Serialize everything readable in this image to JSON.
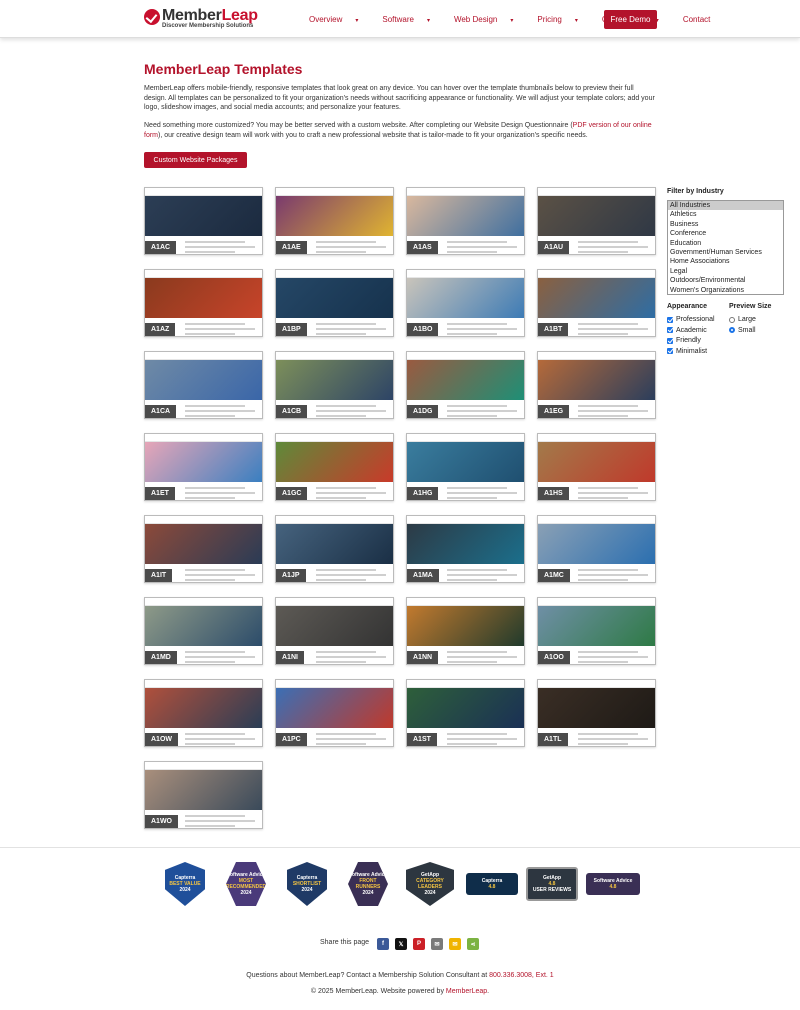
{
  "header": {
    "logo_name_a": "Member",
    "logo_name_b": "Leap",
    "logo_tagline": "Discover Membership Solutions",
    "nav": [
      "Overview",
      "Software",
      "Web Design",
      "Pricing",
      "Get Started",
      "Contact"
    ],
    "nav_has_dropdown": [
      true,
      true,
      true,
      true,
      true,
      false
    ],
    "demo_button": "Free Demo"
  },
  "page": {
    "title": "MemberLeap Templates",
    "intro": "MemberLeap offers mobile-friendly, responsive templates that look great on any device. You can hover over the template thumbnails below to preview their full design. All templates can be personalized to fit your organization's needs without sacrificing appearance or functionality. We will adjust your template colors; add your logo, slideshow images, and social media accounts; and personalize your features.",
    "intro2_a": "Need something more customized? You may be better served with a custom website. After completing our Website Design Questionnaire (",
    "intro2_link": "PDF version of our online form",
    "intro2_b": "), our creative design team will work with you to craft a new professional website that is tailor-made to fit your organization's specific needs.",
    "packages_button": "Custom Website Packages"
  },
  "templates": [
    {
      "code": "A1AC",
      "hero": "#2c3e55",
      "accent": "#1b2a3f"
    },
    {
      "code": "A1AE",
      "hero": "#7a3a6e",
      "accent": "#e0b431"
    },
    {
      "code": "A1AS",
      "hero": "#d9b89e",
      "accent": "#3f6f9f"
    },
    {
      "code": "A1AU",
      "hero": "#5b5145",
      "accent": "#2f3845"
    },
    {
      "code": "A1AZ",
      "hero": "#8a3a1e",
      "accent": "#c8442a"
    },
    {
      "code": "A1BP",
      "hero": "#254766",
      "accent": "#16324d"
    },
    {
      "code": "A1BO",
      "hero": "#c9c4bb",
      "accent": "#3d7bb5"
    },
    {
      "code": "A1BT",
      "hero": "#8a6040",
      "accent": "#2e6da4"
    },
    {
      "code": "A1CA",
      "hero": "#6f8aa6",
      "accent": "#3a66a8"
    },
    {
      "code": "A1CB",
      "hero": "#7d8f5a",
      "accent": "#2d4466"
    },
    {
      "code": "A1DG",
      "hero": "#9a5a40",
      "accent": "#1e8f76"
    },
    {
      "code": "A1EG",
      "hero": "#b56a3a",
      "accent": "#2b3e5c"
    },
    {
      "code": "A1ET",
      "hero": "#e7a6b8",
      "accent": "#3a7fc0"
    },
    {
      "code": "A1GC",
      "hero": "#5e8a3a",
      "accent": "#c93a2a"
    },
    {
      "code": "A1HG",
      "hero": "#3a7d9e",
      "accent": "#1f4f70"
    },
    {
      "code": "A1HS",
      "hero": "#a27a4a",
      "accent": "#c0392b"
    },
    {
      "code": "A1IT",
      "hero": "#8c4a3a",
      "accent": "#2a3b55"
    },
    {
      "code": "A1JP",
      "hero": "#46637e",
      "accent": "#1a2f45"
    },
    {
      "code": "A1MA",
      "hero": "#2d3a45",
      "accent": "#1b6f8c"
    },
    {
      "code": "A1MC",
      "hero": "#8aa0b5",
      "accent": "#2b6fb0"
    },
    {
      "code": "A1MD",
      "hero": "#8e9a88",
      "accent": "#2c4c6a"
    },
    {
      "code": "A1NI",
      "hero": "#5d5a55",
      "accent": "#333333"
    },
    {
      "code": "A1NN",
      "hero": "#c27a2e",
      "accent": "#203a2c"
    },
    {
      "code": "A1OO",
      "hero": "#6f8fa6",
      "accent": "#2e7a45"
    },
    {
      "code": "A1OW",
      "hero": "#b0503c",
      "accent": "#2a3d55"
    },
    {
      "code": "A1PC",
      "hero": "#3b6fb5",
      "accent": "#c0392b"
    },
    {
      "code": "A1ST",
      "hero": "#2e5f3a",
      "accent": "#1a3055"
    },
    {
      "code": "A1TL",
      "hero": "#3a2e25",
      "accent": "#1e1a16"
    },
    {
      "code": "A1WO",
      "hero": "#a98f7c",
      "accent": "#3a4a5a"
    }
  ],
  "filters": {
    "industry_title": "Filter by Industry",
    "industries": [
      "All Industries",
      "Athletics",
      "Business",
      "Conference",
      "Education",
      "Government/Human Services",
      "Home Associations",
      "Legal",
      "Outdoors/Environmental",
      "Women's Organizations"
    ],
    "selected_industry": "All Industries",
    "appearance_title": "Appearance",
    "appearance": [
      "Professional",
      "Academic",
      "Friendly",
      "Minimalist"
    ],
    "preview_title": "Preview Size",
    "preview_sizes": [
      "Large",
      "Small"
    ],
    "preview_selected": "Small"
  },
  "badges": [
    {
      "top": "Capterra",
      "main": "BEST VALUE",
      "year": "2024",
      "color": "#1f4f9a"
    },
    {
      "top": "Software Advice",
      "main": "MOST RECOMMENDED",
      "year": "2024",
      "color": "#4a3a7a"
    },
    {
      "top": "Capterra",
      "main": "SHORTLIST",
      "year": "2024",
      "color": "#1f3a66"
    },
    {
      "top": "Software Advice",
      "main": "FRONT RUNNERS",
      "year": "2024",
      "color": "#3a2f55"
    },
    {
      "top": "GetApp",
      "main": "CATEGORY LEADERS",
      "year": "2024",
      "color": "#2d3640"
    },
    {
      "top": "Capterra",
      "main": "4.8",
      "year": "",
      "color": "#0f2d4a"
    },
    {
      "top": "GetApp",
      "main": "4.8",
      "year": "USER REVIEWS",
      "color": "#2d3640"
    },
    {
      "top": "Software Advice",
      "main": "4.8",
      "year": "",
      "color": "#3a2f55"
    }
  ],
  "share": {
    "label": "Share this page",
    "buttons": [
      {
        "name": "facebook-icon",
        "glyph": "f",
        "color": "#3b5998"
      },
      {
        "name": "x-twitter-icon",
        "glyph": "𝕏",
        "color": "#111111"
      },
      {
        "name": "pinterest-icon",
        "glyph": "P",
        "color": "#cb2027"
      },
      {
        "name": "email-icon",
        "glyph": "✉",
        "color": "#7a7a7a"
      },
      {
        "name": "sms-icon",
        "glyph": "✉",
        "color": "#f0b400"
      },
      {
        "name": "share-icon",
        "glyph": "⋖",
        "color": "#7cb342"
      }
    ]
  },
  "footer": {
    "contact_prefix": "Questions about MemberLeap? Contact a Membership Solution Consultant at ",
    "phone": "800.336.3008, Ext. 1",
    "copyright_prefix": "© 2025 MemberLeap. Website powered by ",
    "powered_by": "MemberLeap",
    "copyright_suffix": "."
  },
  "colors": {
    "brand": "#b3132b"
  }
}
